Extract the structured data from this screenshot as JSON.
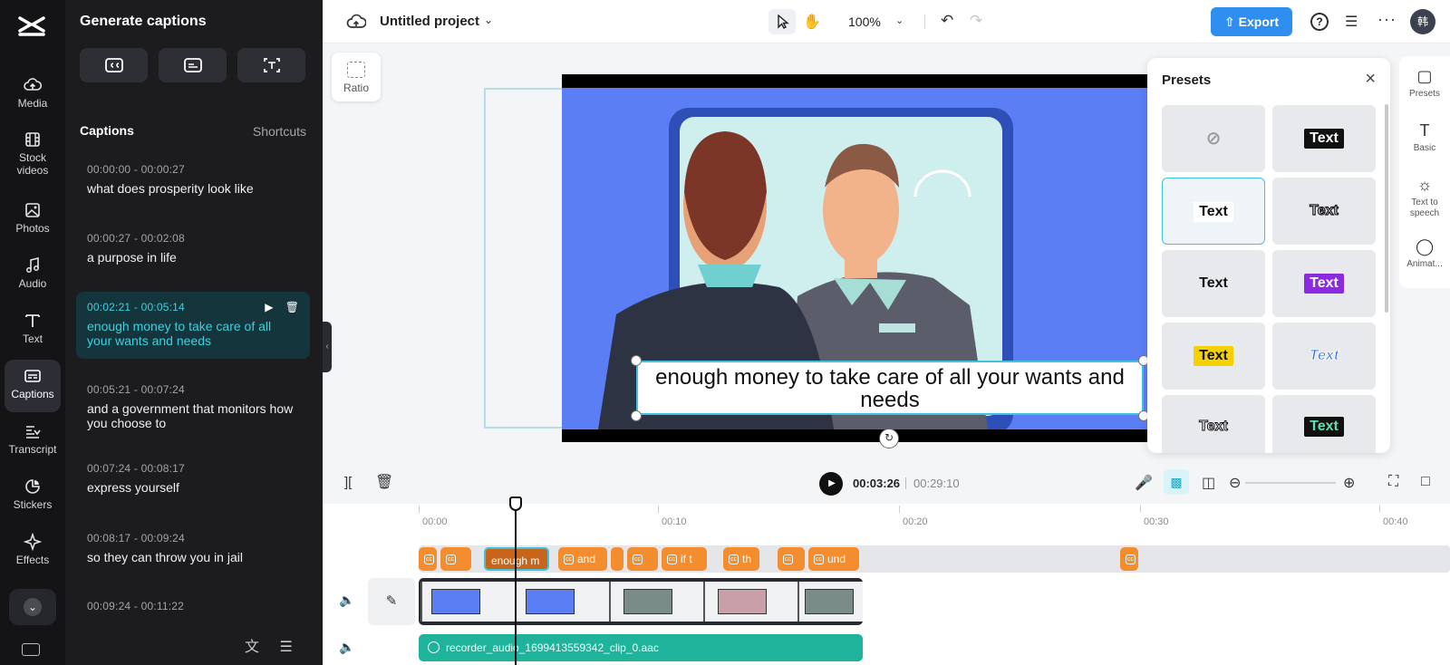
{
  "colors": {
    "accent": "#3fc3dc",
    "export": "#2e8ff0",
    "caption_chip": "#f48d2d",
    "audio": "#1fb39c"
  },
  "rail": {
    "items": [
      {
        "label": "Media",
        "icon": "cloud-upload-icon"
      },
      {
        "label": "Stock videos",
        "icon": "film-icon"
      },
      {
        "label": "Photos",
        "icon": "image-icon"
      },
      {
        "label": "Audio",
        "icon": "music-icon"
      },
      {
        "label": "Text",
        "icon": "text-icon"
      },
      {
        "label": "Captions",
        "icon": "captions-icon"
      },
      {
        "label": "Transcript",
        "icon": "transcript-icon"
      },
      {
        "label": "Stickers",
        "icon": "sticker-icon"
      },
      {
        "label": "Effects",
        "icon": "sparkle-icon"
      }
    ],
    "active": "Captions"
  },
  "captions_panel": {
    "title": "Generate captions",
    "section": "Captions",
    "shortcuts": "Shortcuts",
    "items": [
      {
        "time": "00:00:00 - 00:00:27",
        "text": "what does prosperity look like"
      },
      {
        "time": "00:00:27 - 00:02:08",
        "text": "a purpose in life"
      },
      {
        "time": "00:02:21 - 00:05:14",
        "text": "enough money to take care of all your wants and needs"
      },
      {
        "time": "00:05:21 - 00:07:24",
        "text": "and a government that monitors how you choose to"
      },
      {
        "time": "00:07:24 - 00:08:17",
        "text": "express yourself"
      },
      {
        "time": "00:08:17 - 00:09:24",
        "text": "so they can throw you in jail"
      },
      {
        "time": "00:09:24 - 00:11:22",
        "text": ""
      }
    ]
  },
  "topbar": {
    "project_name": "Untitled project",
    "zoom": "100%",
    "export_label": "Export",
    "avatar": "韩"
  },
  "canvas": {
    "ratio_label": "Ratio",
    "caption_text": "enough money to take care of all your wants and needs"
  },
  "presets": {
    "title": "Presets",
    "tiles": [
      "",
      "Text",
      "Text",
      "Text",
      "Text",
      "Text",
      "Text",
      "Text",
      "Text",
      "Text"
    ]
  },
  "side_tabs": [
    "Presets",
    "Basic",
    "Text to speech",
    "Animat..."
  ],
  "player": {
    "current_time": "00:03:26",
    "total_time": "00:29:10"
  },
  "timeline": {
    "ticks": [
      "00:00",
      "00:10",
      "00:20",
      "00:30",
      "00:40"
    ],
    "caption_chips": [
      "",
      "",
      "enough m",
      "and",
      "",
      "",
      "if t",
      "th",
      "",
      "und",
      ""
    ],
    "audio_clip": "recorder_audio_1699413559342_clip_0.aac"
  }
}
